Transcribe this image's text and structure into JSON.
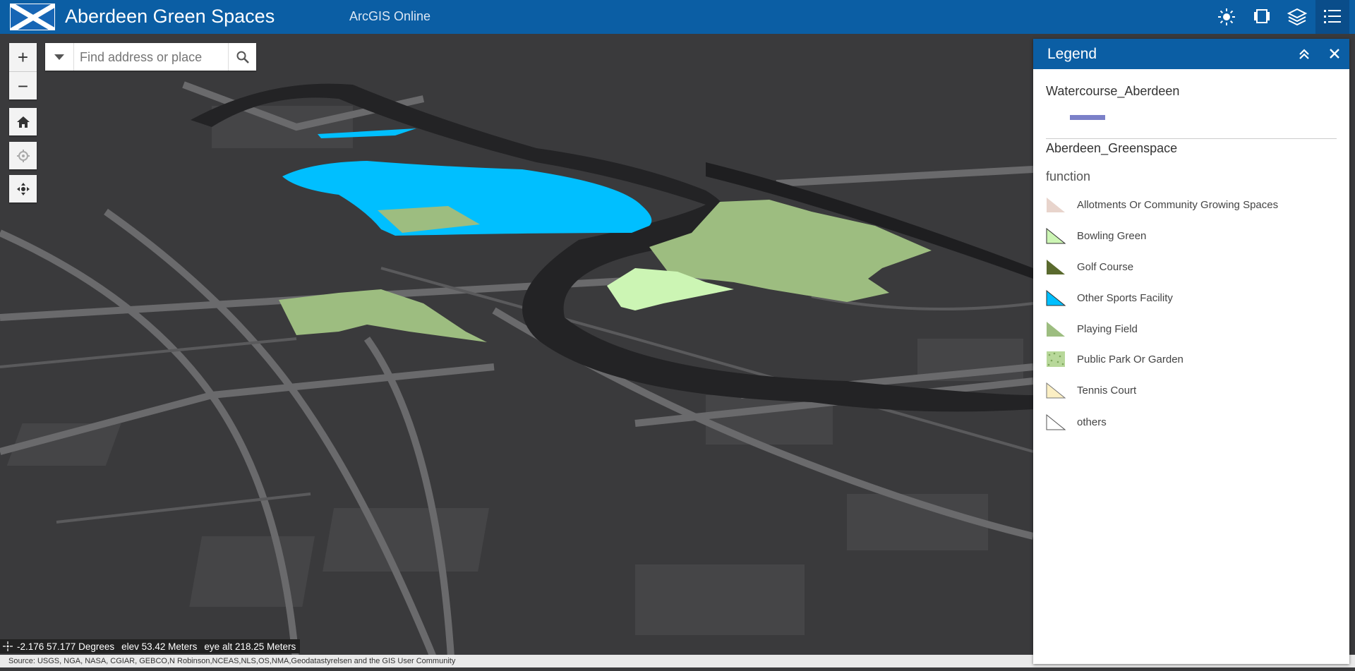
{
  "header": {
    "title": "Aberdeen Green Spaces",
    "subtitle": "ArcGIS Online",
    "buttons": [
      "daylight-icon",
      "slides-icon",
      "layers-icon",
      "legend-icon"
    ]
  },
  "search": {
    "placeholder": "Find address or place"
  },
  "map_tools": [
    "zoom-in",
    "zoom-out",
    "home",
    "locate",
    "navigate"
  ],
  "coordinates": {
    "position": "-2.176 57.177 Degrees",
    "elevation": "elev 53.42 Meters",
    "eye_alt": "eye alt 218.25 Meters"
  },
  "attribution": "Source: USGS, NGA, NASA, CGIAR, GEBCO,N Robinson,NCEAS,NLS,OS,NMA,Geodatastyrelsen and the GIS User Community",
  "legend": {
    "title": "Legend",
    "layers": [
      {
        "name": "Watercourse_Aberdeen"
      },
      {
        "name": "Aberdeen_Greenspace",
        "field": "function"
      }
    ],
    "items": [
      {
        "label": "Allotments Or Community Growing Spaces",
        "color": "#e8d4cc"
      },
      {
        "label": "Bowling Green",
        "color": "#ccf5b4"
      },
      {
        "label": "Golf Course",
        "color": "#5a6a2e"
      },
      {
        "label": "Other Sports Facility",
        "color": "#00bfff"
      },
      {
        "label": "Playing Field",
        "color": "#9dbd80"
      },
      {
        "label": "Public Park Or Garden",
        "color": "#b8d89a"
      },
      {
        "label": "Tennis Court",
        "color": "#fbefc4"
      },
      {
        "label": "others",
        "color": "#ffffff"
      }
    ],
    "watercourse_color": "#7b80c8"
  }
}
